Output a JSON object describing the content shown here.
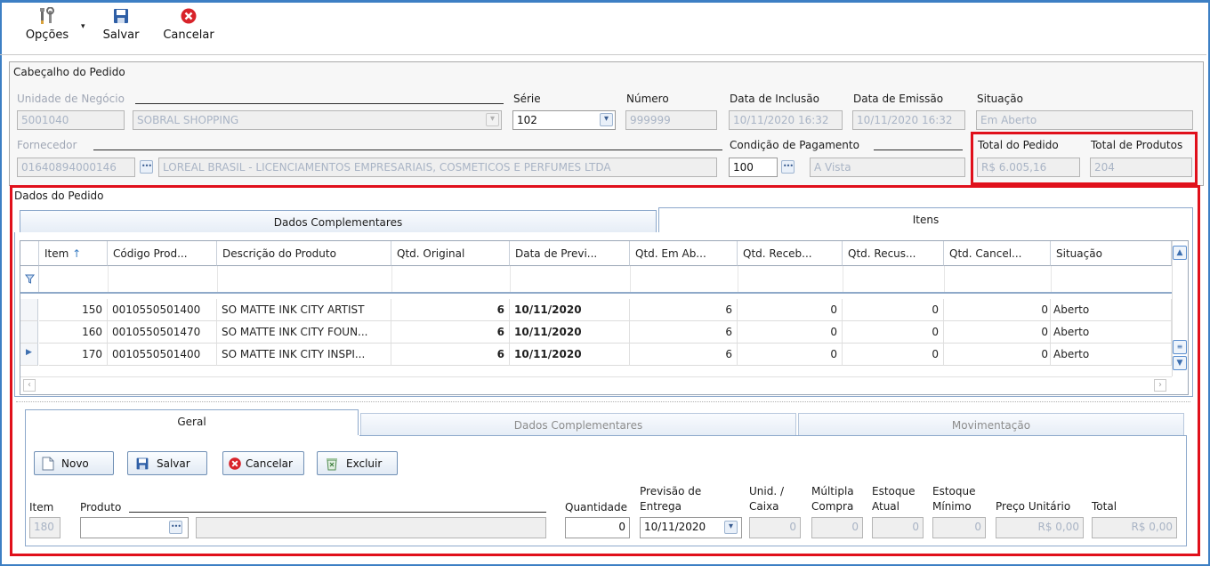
{
  "toolbar": {
    "options_label": "Opções",
    "save_label": "Salvar",
    "cancel_label": "Cancelar"
  },
  "header": {
    "group_title": "Cabeçalho do Pedido",
    "business_unit_label": "Unidade de Negócio",
    "business_unit_code": "5001040",
    "business_unit_name": "SOBRAL SHOPPING",
    "series_label": "Série",
    "series_value": "102",
    "number_label": "Número",
    "number_value": "999999",
    "inclusion_label": "Data de Inclusão",
    "inclusion_value": "10/11/2020 16:32",
    "emission_label": "Data de Emissão",
    "emission_value": "10/11/2020 16:32",
    "status_label": "Situação",
    "status_value": "Em Aberto",
    "supplier_label": "Fornecedor",
    "supplier_code": "01640894000146",
    "supplier_name": "LOREAL BRASIL - LICENCIAMENTOS EMPRESARIAIS, COSMETICOS E PERFUMES LTDA",
    "payment_label": "Condição de Pagamento",
    "payment_code": "100",
    "payment_name": "A Vista",
    "order_total_label": "Total do Pedido",
    "order_total_value": "R$ 6.005,16",
    "products_total_label": "Total de Produtos",
    "products_total_value": "204"
  },
  "order": {
    "group_title": "Dados do Pedido",
    "tabs": [
      "Dados Complementares",
      "Itens"
    ],
    "columns": [
      "Item",
      "Código Prod...",
      "Descrição do Produto",
      "Qtd. Original",
      "Data de Previ...",
      "Qtd. Em Ab...",
      "Qtd. Receb...",
      "Qtd. Recus...",
      "Qtd. Cancel...",
      "Situação"
    ],
    "rows": [
      {
        "item": "150",
        "code": "0010550501400",
        "desc": "SO MATTE INK CITY ARTIST",
        "orig": "6",
        "date": "10/11/2020",
        "open": "6",
        "recv": "0",
        "ref": "0",
        "canc": "0",
        "status": "Aberto"
      },
      {
        "item": "160",
        "code": "0010550501470",
        "desc": "SO MATTE INK CITY FOUN...",
        "orig": "6",
        "date": "10/11/2020",
        "open": "6",
        "recv": "0",
        "ref": "0",
        "canc": "0",
        "status": "Aberto"
      },
      {
        "item": "170",
        "code": "0010550501400",
        "desc": "SO MATTE INK CITY INSPI...",
        "orig": "6",
        "date": "10/11/2020",
        "open": "6",
        "recv": "0",
        "ref": "0",
        "canc": "0",
        "status": "Aberto"
      }
    ]
  },
  "item_panel": {
    "tabs": [
      "Geral",
      "Dados Complementares",
      "Movimentação"
    ],
    "buttons": {
      "new": "Novo",
      "save": "Salvar",
      "cancel": "Cancelar",
      "delete": "Excluir"
    },
    "labels": {
      "item": "Item",
      "product": "Produto",
      "quantity": "Quantidade",
      "forecast_line1": "Previsão de",
      "forecast_line2": "Entrega",
      "unit_line1": "Unid. /",
      "unit_line2": "Caixa",
      "multiple_line1": "Múltipla",
      "multiple_line2": "Compra",
      "stock_line1": "Estoque",
      "stock_line2": "Atual",
      "minstock_line1": "Estoque",
      "minstock_line2": "Mínimo",
      "unit_price": "Preço Unitário",
      "total": "Total"
    },
    "values": {
      "item": "180",
      "product_code": "",
      "product_desc": "",
      "quantity": "0",
      "forecast_date": "10/11/2020",
      "unit_box": "0",
      "multiple": "0",
      "stock": "0",
      "min_stock": "0",
      "unit_price": "R$ 0,00",
      "total": "R$ 0,00"
    }
  },
  "colors": {
    "highlight": "#e0101b",
    "tab_border": "#8ca8cb",
    "window_border": "#3d7fc4"
  },
  "icons": {
    "options": "tools-icon",
    "save": "floppy-disk-icon",
    "cancel": "red-x-circle-icon",
    "lookup": "ellipsis-icon",
    "dropdown": "chevron-down-icon",
    "sort": "arrow-up-icon",
    "filter": "filter-icon"
  }
}
